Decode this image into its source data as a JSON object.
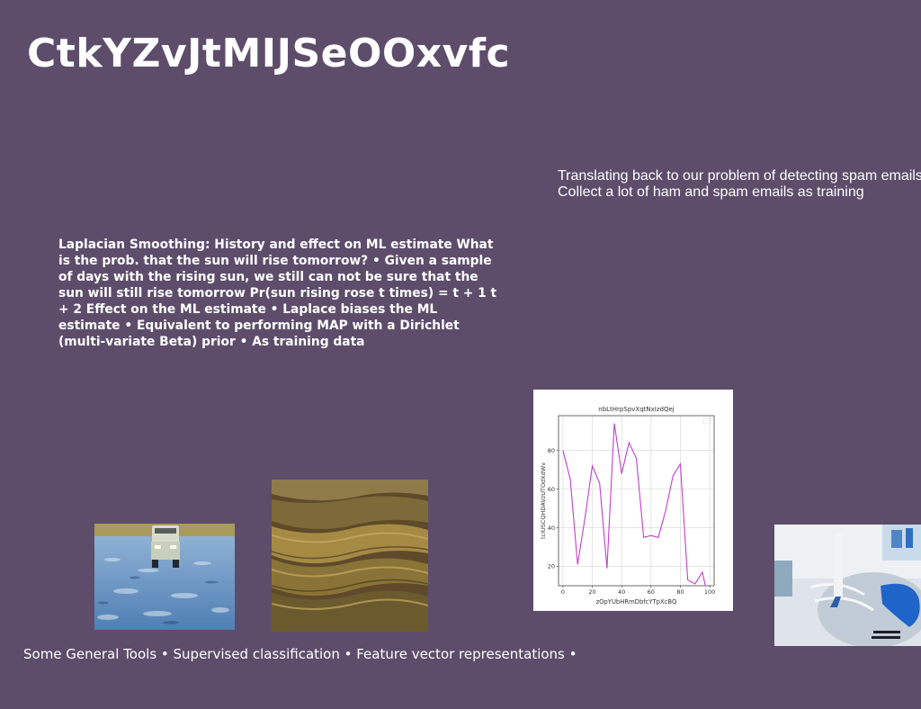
{
  "slide": {
    "title": "CtkYZvJtMIJSeOOxvfc",
    "side_text_line1": "Translating back to our problem of detecting spam emails",
    "side_text_line2": "Collect a lot of ham and spam emails as training",
    "body_text": "Laplacian Smoothing: History and effect on ML estimate What is the prob. that the sun will rise tomorrow? • Given a sample of days with the rising sun, we still can not be sure that the sun will still rise tomorrow Pr(sun rising rose t times) = t + 1 t + 2 Effect on the ML estimate • Laplace biases the ML estimate • Equivalent to performing MAP with a Dirichlet (multi-variate Beta) prior • As training data",
    "footer_text": "Some General Tools • Supervised classification • Feature vector representations •"
  },
  "chart_data": {
    "type": "line",
    "title": "nbLtHrpSpvXqtNxIzdQej",
    "xlabel": "zOpYUbHRmDbfcYTpXcBQ",
    "ylabel": "tcIUSCQHDAVzUTOdXdWv",
    "xlim": [
      -3,
      103
    ],
    "ylim": [
      10,
      98
    ],
    "xticks": [
      0,
      20,
      40,
      60,
      80,
      100
    ],
    "yticks": [
      20,
      40,
      60,
      80
    ],
    "grid": true,
    "legend": "top-right",
    "series": [
      {
        "color": "#c23fc8",
        "x": [
          0,
          5,
          10,
          15,
          20,
          25,
          30,
          35,
          40,
          45,
          50,
          55,
          60,
          65,
          70,
          75,
          80,
          85,
          90,
          95,
          100
        ],
        "y": [
          80,
          65,
          21,
          45,
          72,
          63,
          19,
          94,
          68,
          84,
          76,
          35,
          36,
          35,
          49,
          67,
          73,
          13,
          11,
          17,
          0
        ]
      }
    ]
  }
}
